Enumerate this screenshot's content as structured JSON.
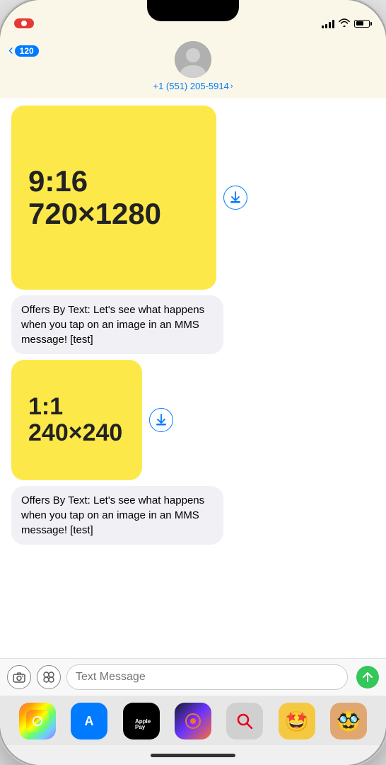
{
  "status": {
    "record_label": "",
    "back_count": "120",
    "contact_phone": "+1 (551) 205-5914"
  },
  "messages": [
    {
      "id": "msg1",
      "type": "image",
      "size": "large",
      "image_text_line1": "9:16",
      "image_text_line2": "720×1280",
      "caption": "Offers By Text: Let's see what happens when you tap on an image in an MMS message! [test]"
    },
    {
      "id": "msg2",
      "type": "image",
      "size": "small",
      "image_text_line1": "1:1",
      "image_text_line2": "240×240",
      "caption": "Offers By Text: Let's see what happens when you tap on an image in an MMS message! [test]"
    }
  ],
  "input": {
    "placeholder": "Text Message"
  },
  "dock": {
    "apps": [
      {
        "id": "photos",
        "label": "Photos",
        "icon": "🌈"
      },
      {
        "id": "appstore",
        "label": "App Store",
        "icon": "🅰"
      },
      {
        "id": "applepay",
        "label": "Apple Pay",
        "icon": ""
      },
      {
        "id": "circle",
        "label": "Action Button",
        "icon": "🎯"
      },
      {
        "id": "search",
        "label": "Spotlight",
        "icon": "🔍"
      },
      {
        "id": "memoji1",
        "label": "Memoji 1",
        "icon": "🤩"
      },
      {
        "id": "memoji2",
        "label": "Memoji 2",
        "icon": "🥸"
      }
    ]
  }
}
